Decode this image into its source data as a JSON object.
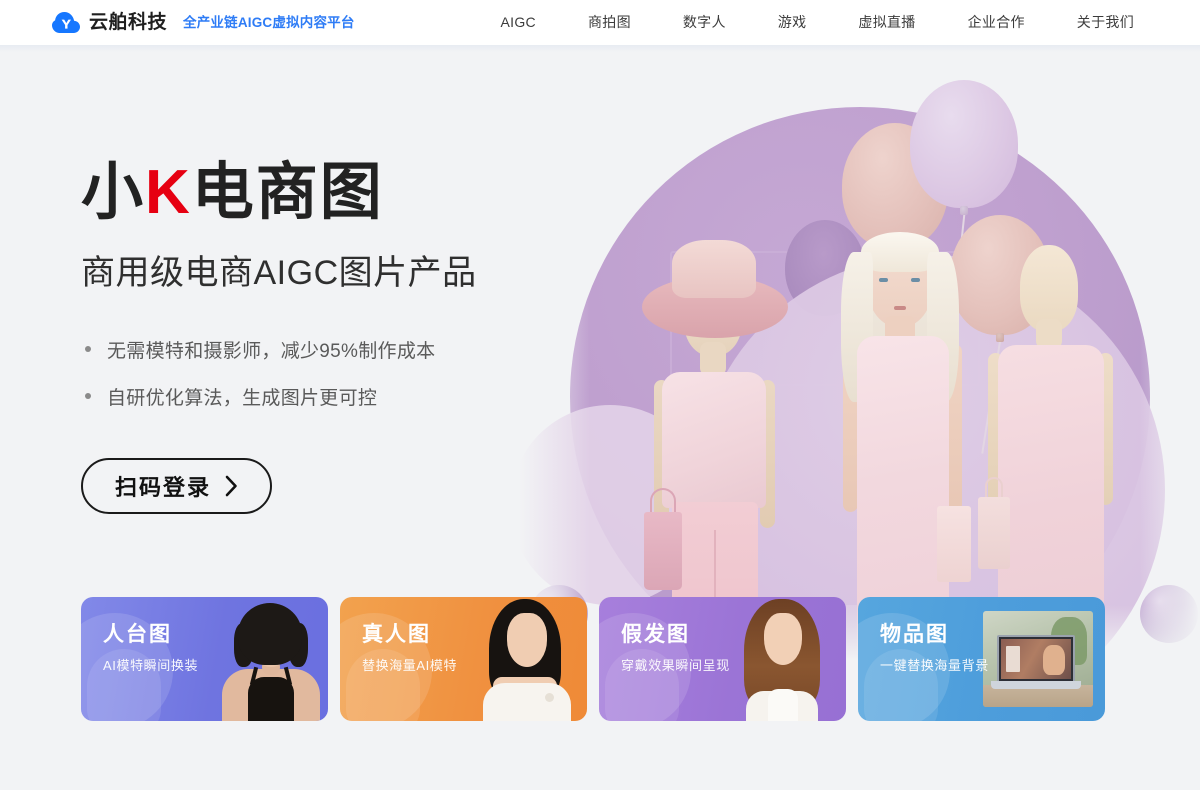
{
  "header": {
    "logo_icon": "cloud-y-logo-icon",
    "brand_name": "云舶科技",
    "tagline": "全产业链AIGC虚拟内容平台",
    "brand_color": "#2e7cf6",
    "nav": [
      {
        "label": "AIGC"
      },
      {
        "label": "商拍图"
      },
      {
        "label": "数字人"
      },
      {
        "label": "游戏"
      },
      {
        "label": "虚拟直播"
      },
      {
        "label": "企业合作"
      },
      {
        "label": "关于我们"
      }
    ]
  },
  "hero": {
    "title_prefix": "小",
    "title_highlight": "K",
    "title_suffix": "电商图",
    "highlight_color": "#e60012",
    "subtitle": "商用级电商AIGC图片产品",
    "bullets": [
      "无需模特和摄影师，减少95%制作成本",
      "自研优化算法，生成图片更可控"
    ],
    "cta_label": "扫码登录",
    "cta_icon": "chevron-right-icon"
  },
  "cards": [
    {
      "title": "人台图",
      "subtitle": "AI模特瞬间换装",
      "color": "#6f74e0",
      "photo": "short-hair-model-photo"
    },
    {
      "title": "真人图",
      "subtitle": "替换海量AI模特",
      "color": "#f09140",
      "photo": "long-hair-model-photo"
    },
    {
      "title": "假发图",
      "subtitle": "穿戴效果瞬间呈现",
      "color": "#9b74d6",
      "photo": "brown-hair-model-photo"
    },
    {
      "title": "物品图",
      "subtitle": "一键替换海量背景",
      "color": "#4d9ddb",
      "photo": "laptop-product-photo"
    }
  ],
  "artwork": {
    "description": "三个粉色服装人台与真人模特，紫色圆形背景与粉色气球",
    "background_color": "#f2f3f5"
  }
}
